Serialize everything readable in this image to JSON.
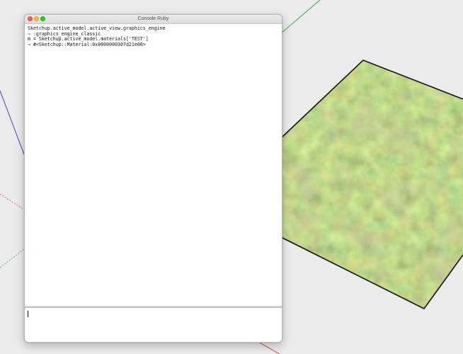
{
  "window": {
    "title": "Console Ruby"
  },
  "console": {
    "lines": [
      "Sketchup.active_model.active_view.graphics_engine",
      "⇒ :graphics_engine_classic",
      "m = Sketchup.active_model.materials['TEST']",
      "⇒ #<Sketchup::Material:0x0000000307d21e00>"
    ],
    "input_value": ""
  },
  "colors": {
    "viewport_background": "#ebebeb",
    "axis_green": "#3ca83c",
    "axis_blue": "#3b3bbf",
    "axis_red": "#d84a4a",
    "grass_base": "#7d8a3a",
    "plane_edge": "#111111"
  },
  "icons": {
    "close": "traffic-light-close-icon",
    "minimize": "traffic-light-minimize-icon",
    "maximize": "traffic-light-maximize-icon"
  }
}
